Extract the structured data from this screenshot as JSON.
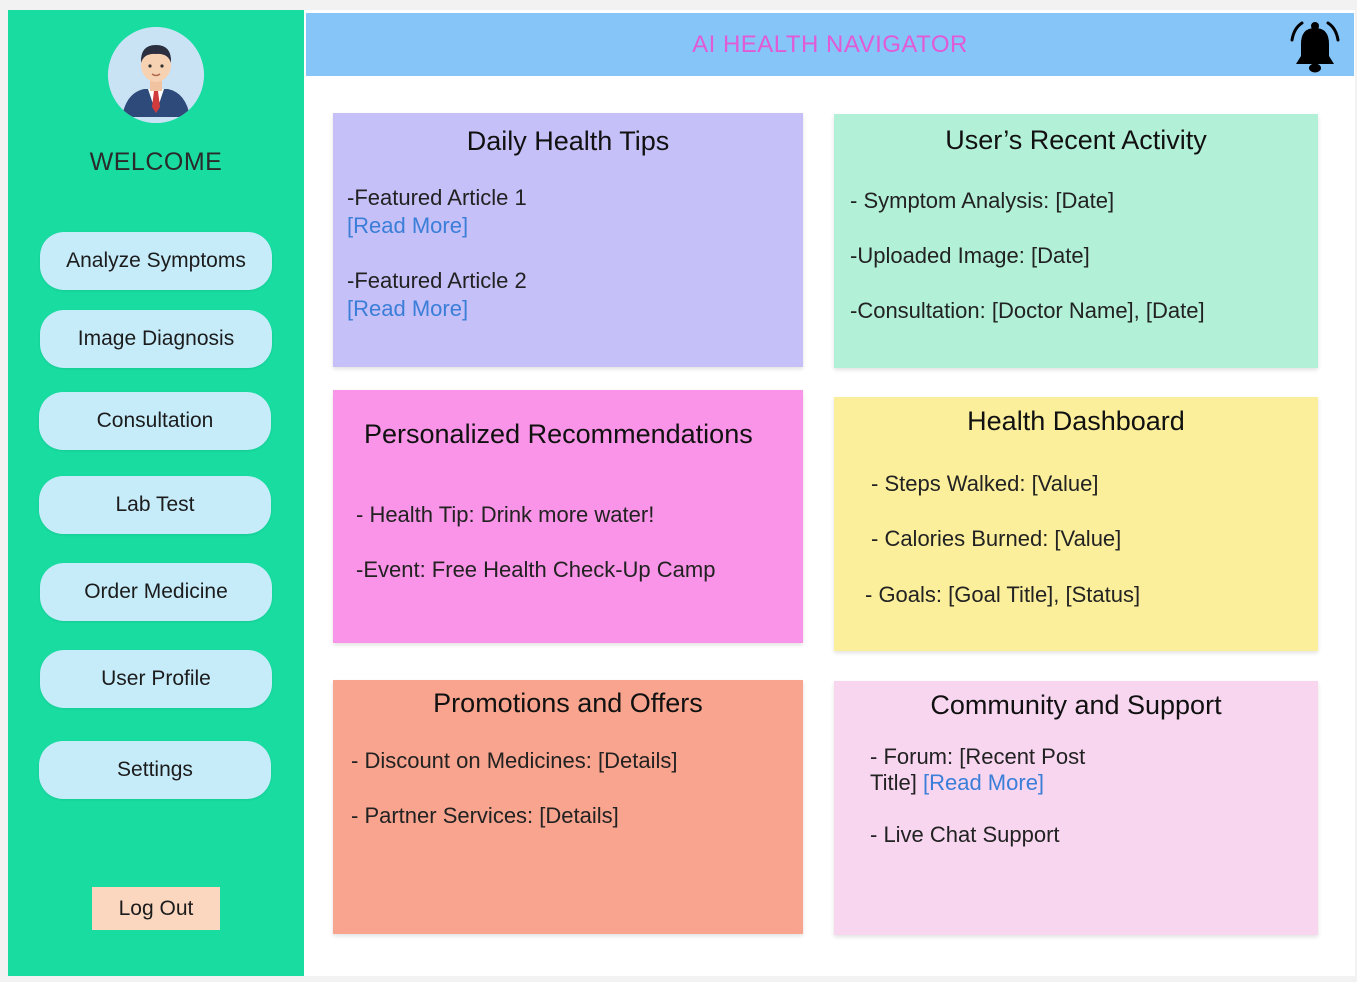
{
  "colors": {
    "sidebar": "#18dca0",
    "header": "#86c5f8",
    "header_title": "#e15ad6",
    "nav_button": "#c6ecfa",
    "logout_button": "#fbd7c0",
    "link": "#3a7ed8",
    "card_tips": "#c5c0f8",
    "card_activity": "#b3f0d8",
    "card_recommendations": "#f994e8",
    "card_dashboard": "#fbef9c",
    "card_promotions": "#f8a48e",
    "card_community": "#f8d6f0"
  },
  "sidebar": {
    "avatar_icon": "user-avatar-icon",
    "welcome": "WELCOME",
    "nav": [
      {
        "label": "Analyze Symptoms"
      },
      {
        "label": "Image Diagnosis"
      },
      {
        "label": "Consultation"
      },
      {
        "label": "Lab Test"
      },
      {
        "label": "Order Medicine"
      },
      {
        "label": "User Profile"
      },
      {
        "label": "Settings"
      }
    ],
    "logout": "Log Out"
  },
  "header": {
    "title": "AI HEALTH NAVIGATOR",
    "notification_icon": "bell-icon"
  },
  "cards": {
    "tips": {
      "title": "Daily Health Tips",
      "article1": "-Featured Article 1",
      "article1_link": "[Read More]",
      "article2": "-Featured Article 2",
      "article2_link": "[Read More]"
    },
    "activity": {
      "title": "User’s Recent Activity",
      "items": [
        "- Symptom Analysis: [Date]",
        "-Uploaded Image: [Date]",
        "-Consultation: [Doctor Name], [Date]"
      ]
    },
    "recommendations": {
      "title": "Personalized Recommendations",
      "items": [
        "- Health Tip: Drink more water!",
        "-Event: Free Health Check-Up Camp"
      ]
    },
    "dashboard": {
      "title": "Health Dashboard",
      "items": [
        "- Steps Walked: [Value]",
        "- Calories Burned: [Value]",
        "- Goals: [Goal Title], [Status]"
      ]
    },
    "promotions": {
      "title": "Promotions and Offers",
      "items": [
        "- Discount on Medicines: [Details]",
        "- Partner Services: [Details]"
      ]
    },
    "community": {
      "title": "Community and Support",
      "forum_line1": "- Forum: [Recent Post",
      "forum_line2": "Title]",
      "forum_link": "[Read More]",
      "live_chat": "- Live Chat Support"
    }
  }
}
